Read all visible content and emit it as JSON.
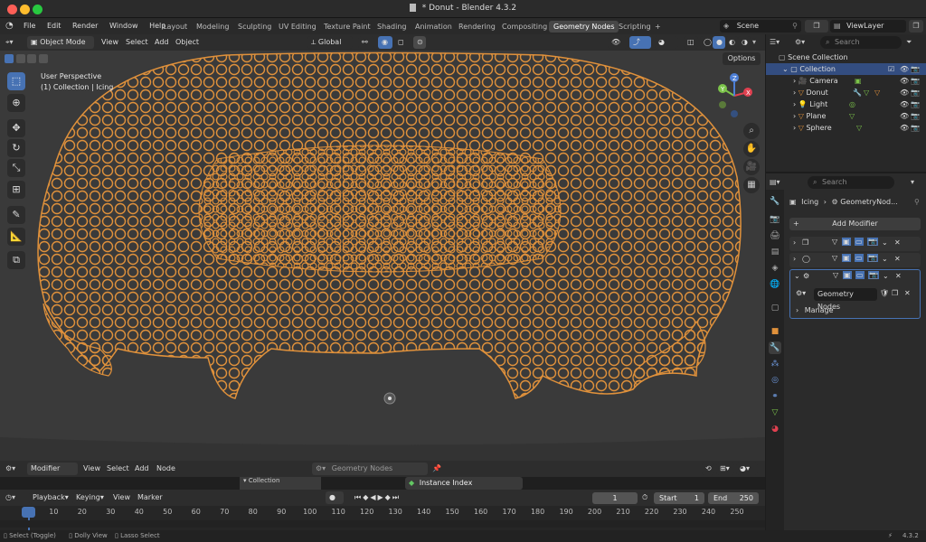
{
  "window": {
    "title": "* Donut - Blender 4.3.2"
  },
  "menu": [
    "File",
    "Edit",
    "Render",
    "Window",
    "Help"
  ],
  "workspace_tabs": [
    {
      "label": "Layout",
      "active": false
    },
    {
      "label": "Modeling",
      "active": false
    },
    {
      "label": "Sculpting",
      "active": false
    },
    {
      "label": "UV Editing",
      "active": false
    },
    {
      "label": "Texture Paint",
      "active": false
    },
    {
      "label": "Shading",
      "active": false
    },
    {
      "label": "Animation",
      "active": false
    },
    {
      "label": "Rendering",
      "active": false
    },
    {
      "label": "Compositing",
      "active": false
    },
    {
      "label": "Geometry Nodes",
      "active": true
    },
    {
      "label": "Scripting",
      "active": false
    }
  ],
  "add_workspace": "+",
  "scene": {
    "name": "Scene",
    "view_layer": "ViewLayer"
  },
  "viewport_header": {
    "mode": "Object Mode",
    "menus": [
      "View",
      "Select",
      "Add",
      "Object"
    ],
    "orientation": "Global",
    "options": "Options"
  },
  "viewport": {
    "perspective": "User Perspective",
    "collection": "(1) Collection | Icing"
  },
  "gizmo": {
    "x": "X",
    "y": "Y",
    "z": "Z"
  },
  "outliner": {
    "search_placeholder": "Search",
    "scene_collection": "Scene Collection",
    "items": [
      {
        "label": "Collection"
      },
      {
        "label": "Camera"
      },
      {
        "label": "Donut"
      },
      {
        "label": "Light"
      },
      {
        "label": "Plane"
      },
      {
        "label": "Sphere"
      }
    ]
  },
  "properties": {
    "search_placeholder": "Search",
    "breadcrumb_object": "Icing",
    "breadcrumb_modifier": "GeometryNod...",
    "add_modifier": "Add Modifier",
    "nodegroup_name": "Geometry Nodes",
    "manage": "Manage"
  },
  "node_editor": {
    "mode": "Modifier",
    "menus": [
      "View",
      "Select",
      "Add",
      "Node"
    ],
    "nodegroup": "Geometry Nodes",
    "partial_node": "Instance Index",
    "partial_frame": "Collection"
  },
  "timeline": {
    "menus": [
      "Playback",
      "Keying",
      "View",
      "Marker"
    ],
    "current_frame": "1",
    "start_label": "Start",
    "start": "1",
    "end_label": "End",
    "end": "250",
    "ticks": [
      "1",
      "10",
      "20",
      "30",
      "40",
      "50",
      "60",
      "70",
      "80",
      "90",
      "100",
      "110",
      "120",
      "130",
      "140",
      "150",
      "160",
      "170",
      "180",
      "190",
      "200",
      "210",
      "220",
      "230",
      "240",
      "250"
    ]
  },
  "statusbar": {
    "select": "Select (Toggle)",
    "dolly": "Dolly View",
    "lasso": "Lasso Select",
    "version": "4.3.2"
  },
  "colors": {
    "selection_orange": "#e0913b",
    "active_blue": "#4772b3",
    "viewport_bg": "#3a3a3a"
  }
}
